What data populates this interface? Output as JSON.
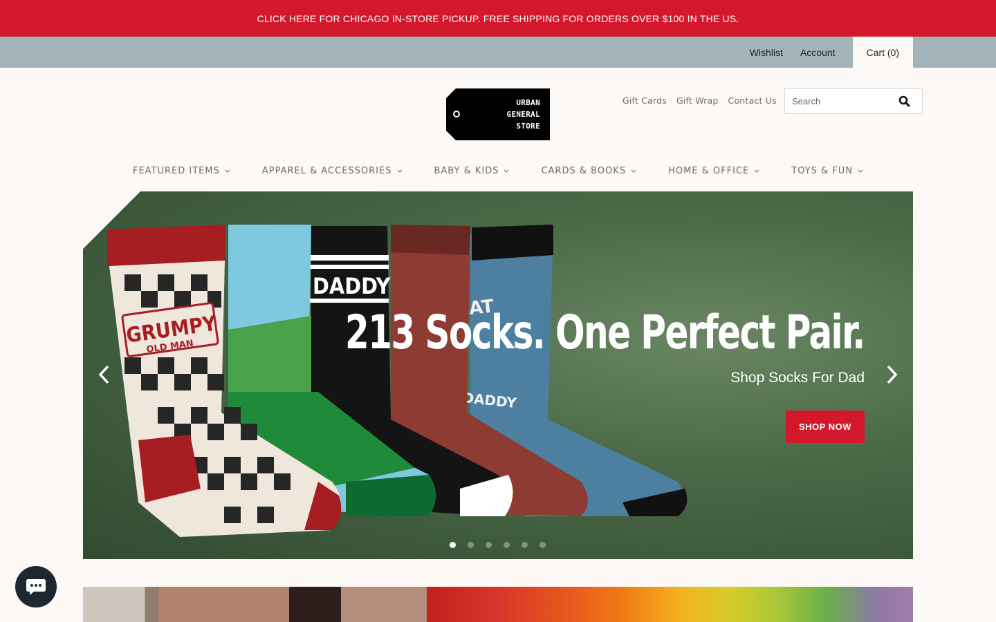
{
  "promo_bar": {
    "text": "CLICK HERE FOR CHICAGO IN-STORE PICKUP. FREE SHIPPING FOR ORDERS OVER $100 IN THE US."
  },
  "account_bar": {
    "wishlist": "Wishlist",
    "account": "Account",
    "cart": "Cart (0)"
  },
  "logo": {
    "line1": "URBAN",
    "line2": "GENERAL",
    "line3": "STORE"
  },
  "utility_links": {
    "gift_cards": "Gift Cards",
    "gift_wrap": "Gift Wrap",
    "contact_us": "Contact Us"
  },
  "search": {
    "placeholder": "Search"
  },
  "nav": {
    "items": [
      {
        "label": "FEATURED ITEMS"
      },
      {
        "label": "APPAREL & ACCESSORIES"
      },
      {
        "label": "BABY & KIDS"
      },
      {
        "label": "CARDS & BOOKS"
      },
      {
        "label": "HOME & OFFICE"
      },
      {
        "label": "TOYS & FUN"
      }
    ]
  },
  "hero": {
    "title": "213 Socks. One Perfect Pair.",
    "subtitle": "Shop Socks For Dad",
    "button": "SHOP NOW",
    "slide_count": 6,
    "active_slide": 1,
    "sock_labels": {
      "grumpy": "GRUMPY",
      "old_man": "OLD MAN",
      "daddy": "DADDY",
      "cat": "CAT",
      "cat_daddy": "DADDY"
    }
  },
  "colors": {
    "brand_red": "#d4182c",
    "account_bar": "#a2b4b9",
    "page_bg": "#fdf9f6",
    "chat": "#1c2732"
  }
}
